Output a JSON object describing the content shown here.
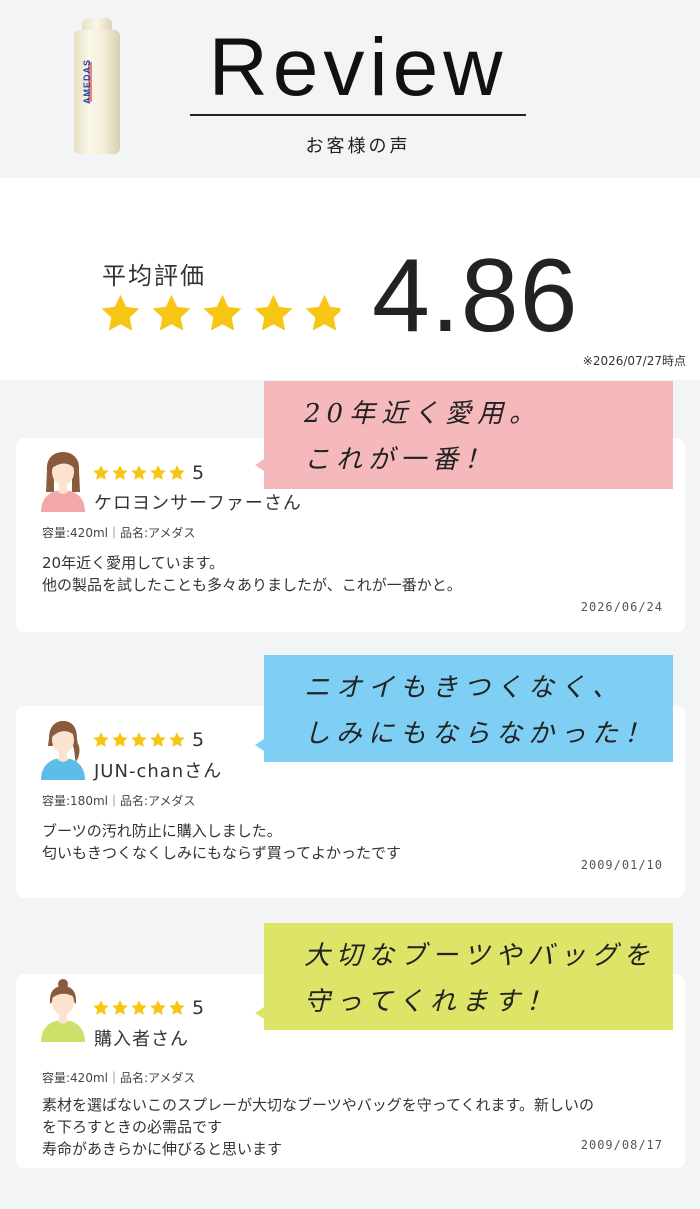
{
  "header": {
    "product_label": "AMEDAS",
    "title": "Review",
    "subtitle": "お客様の声"
  },
  "rating": {
    "label": "平均評価",
    "value": "4.86",
    "stars": 4.86,
    "as_of": "※2026/07/27時点",
    "star_color": "#f7c514"
  },
  "reviews": [
    {
      "highlight": "20年近く愛用。\nこれが一番！",
      "highlight_color": "#f5b9bb",
      "avatar": "woman-long-hair-avatar-icon",
      "avatar_color": "#f3a7aa",
      "rating": 5,
      "score": "5",
      "nickname": "ケロヨンサーファーさん",
      "meta": "容量:420ml｜品名:アメダス",
      "body": "20年近く愛用しています。\n他の製品を試したことも多々ありましたが、これが一番かと。",
      "date": "2026/06/24"
    },
    {
      "highlight": "ニオイもきつくなく、\nしみにもならなかった！",
      "highlight_color": "#7fcff5",
      "avatar": "woman-ponytail-avatar-icon",
      "avatar_color": "#5bbde8",
      "rating": 5,
      "score": "5",
      "nickname": "JUN-chanさん",
      "meta": "容量:180ml｜品名:アメダス",
      "body": "ブーツの汚れ防止に購入しました。\n匂いもきつくなくしみにもならず買ってよかったです",
      "date": "2009/01/10"
    },
    {
      "highlight": "大切なブーツやバッグを\n守ってくれます！",
      "highlight_color": "#dde468",
      "avatar": "woman-bun-hair-avatar-icon",
      "avatar_color": "#cfe06a",
      "rating": 5,
      "score": "5",
      "nickname": "購入者さん",
      "meta": "容量:420ml｜品名:アメダス",
      "body": "素材を選ばないこのスプレーが大切なブーツやバッグを守ってくれます。新しいの\nを下ろすときの必需品です\n寿命があきらかに伸びると思います",
      "date": "2009/08/17"
    }
  ]
}
